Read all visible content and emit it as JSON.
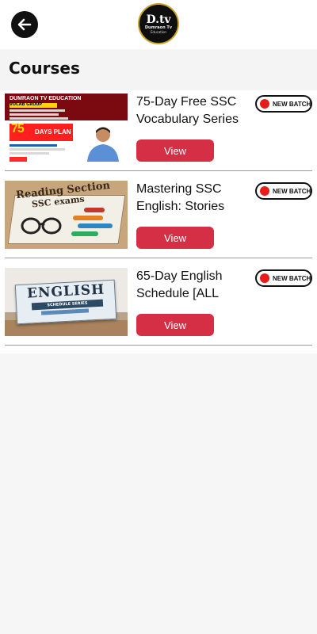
{
  "header": {
    "back_icon": "arrow-left-icon",
    "logo": {
      "main": "D.tv",
      "sub": "Dumraon Tv",
      "sub2": "Education"
    }
  },
  "page": {
    "title": "Courses"
  },
  "badge_color": "#e81b1b",
  "button_color": "#d42f45",
  "courses": [
    {
      "title": "75-Day Free SSC Vocabulary Series",
      "badge": "NEW BATCH",
      "button": "View",
      "thumb": {
        "heading": "DUMRAON TV EDUCATION",
        "band": "VOCAB GROUP",
        "big": "75",
        "big2": "DAYS PLAN"
      }
    },
    {
      "title": "Mastering SSC English: Stories",
      "badge": "NEW BATCH",
      "button": "View",
      "thumb": {
        "line1": "Reading Section",
        "line2": "SSC exams"
      }
    },
    {
      "title": "65-Day English Schedule [ALL",
      "badge": "NEW BATCH",
      "button": "View",
      "thumb": {
        "title": "ENGLISH",
        "sub": "SCHEDULE SERIES"
      }
    }
  ]
}
